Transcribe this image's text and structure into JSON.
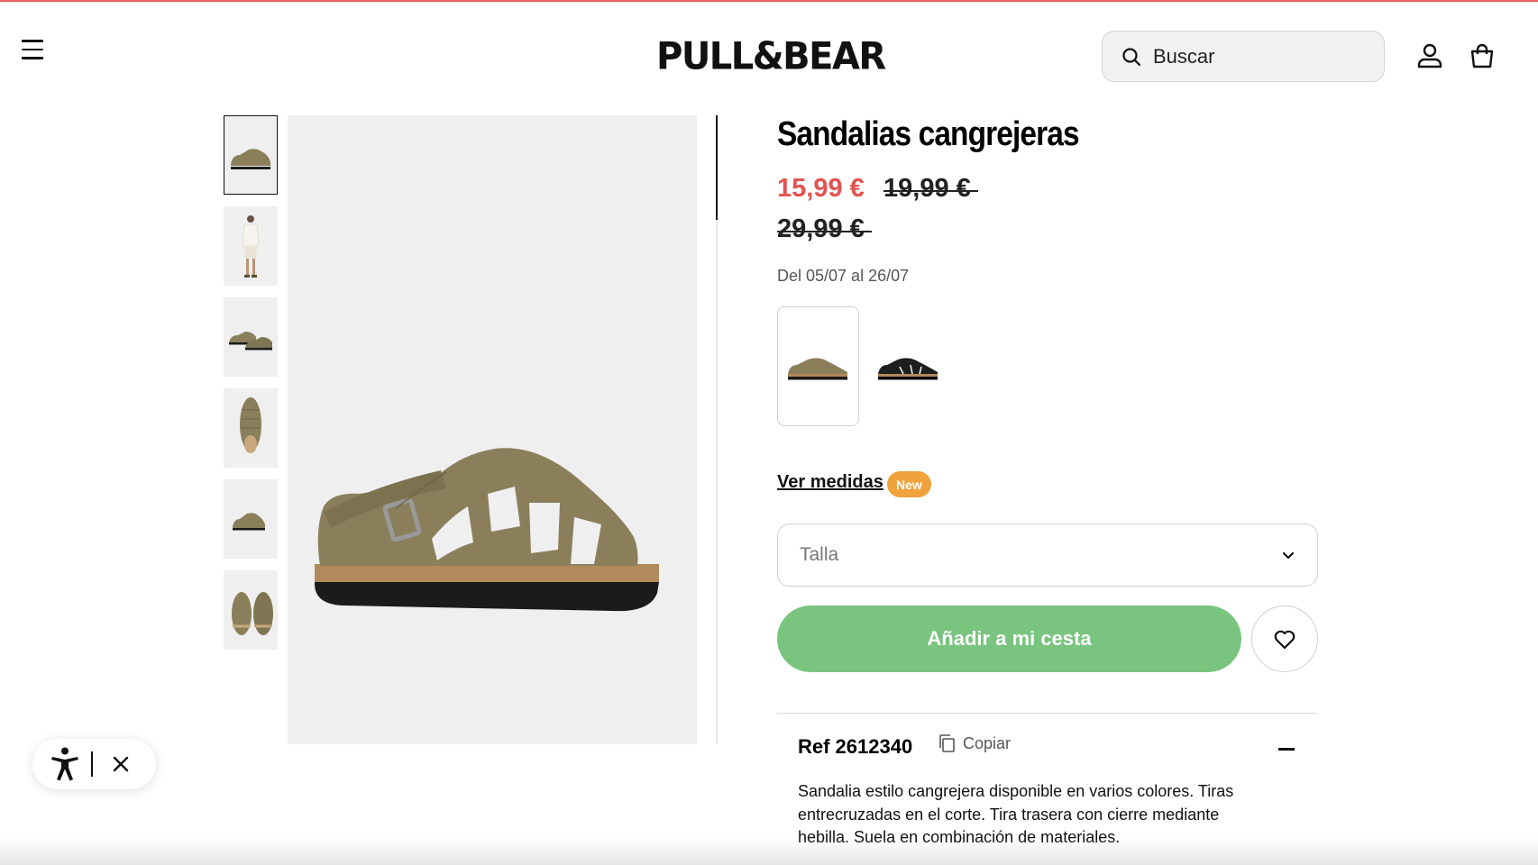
{
  "header": {
    "logo": "PULL&BEAR",
    "search_placeholder": "Buscar",
    "icons": [
      "menu-icon",
      "search-icon",
      "user-icon",
      "bag-icon"
    ]
  },
  "gallery": {
    "thumbnails": [
      {
        "alt": "Sandalia vista lateral",
        "active": true
      },
      {
        "alt": "Modelo con look completo",
        "active": false
      },
      {
        "alt": "Par de sandalias",
        "active": false
      },
      {
        "alt": "Sandalia vista superior",
        "active": false
      },
      {
        "alt": "Sandalia vista lateral pequeña",
        "active": false
      },
      {
        "alt": "Par de sandalias frontal",
        "active": false
      }
    ]
  },
  "product": {
    "title": "Sandalias cangrejeras",
    "price_current": "15,99 €",
    "price_previous": "19,99 €",
    "price_original": "29,99 €",
    "promo_dates": "Del 05/07 al 26/07",
    "colors": [
      {
        "name": "Caqui",
        "hex": "#8a7f5a",
        "selected": true
      },
      {
        "name": "Negro",
        "hex": "#1e1e1e",
        "selected": false
      }
    ],
    "size_guide_label": "Ver medidas",
    "size_guide_badge": "New",
    "size_placeholder": "Talla",
    "add_to_cart_label": "Añadir a mi cesta",
    "reference": "Ref 2612340",
    "copy_label": "Copiar",
    "description": "Sandalia estilo cangrejera disponible en varios colores. Tiras entrecruzadas en el corte. Tira trasera con cierre mediante hebilla. Suela en combinación de materiales."
  },
  "colors": {
    "sale_price": "#e25451",
    "add_button": "#79c47f",
    "badge": "#f0a23c",
    "accent_line": "#e8605a"
  }
}
